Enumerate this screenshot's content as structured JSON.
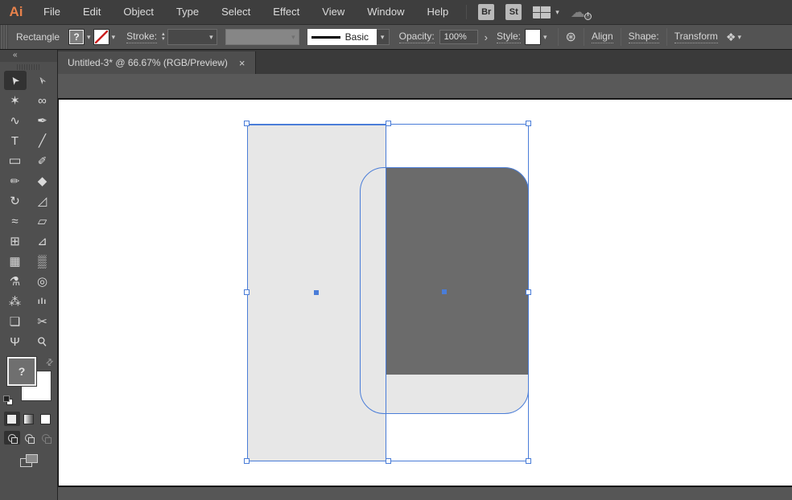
{
  "app": {
    "logo": "Ai"
  },
  "menubar": {
    "items": [
      "File",
      "Edit",
      "Object",
      "Type",
      "Select",
      "Effect",
      "View",
      "Window",
      "Help"
    ],
    "bridge_label": "Br",
    "stock_label": "St"
  },
  "controlbar": {
    "context_label": "Rectangle",
    "fill_value": "?",
    "stroke_label": "Stroke:",
    "brush_name": "Basic",
    "opacity_label": "Opacity:",
    "opacity_value": "100%",
    "style_label": "Style:",
    "align_label": "Align",
    "shape_label": "Shape:",
    "transform_label": "Transform"
  },
  "tabbar": {
    "title": "Untitled-3* @ 66.67% (RGB/Preview)",
    "close": "×"
  },
  "toolbar": {
    "collapse": "«",
    "fill_value": "?",
    "tools": [
      {
        "name": "selection-tool",
        "glyph": "➤",
        "active": true
      },
      {
        "name": "direct-selection-tool",
        "glyph": "➣"
      },
      {
        "name": "magic-wand-tool",
        "glyph": "✶"
      },
      {
        "name": "lasso-tool",
        "glyph": "∞"
      },
      {
        "name": "curvature-tool",
        "glyph": "∿"
      },
      {
        "name": "pen-tool",
        "glyph": "✒"
      },
      {
        "name": "type-tool",
        "glyph": "T"
      },
      {
        "name": "line-segment-tool",
        "glyph": "╱"
      },
      {
        "name": "rectangle-tool",
        "glyph": "▭"
      },
      {
        "name": "paintbrush-tool",
        "glyph": "✐"
      },
      {
        "name": "pencil-tool",
        "glyph": "✏"
      },
      {
        "name": "eraser-tool",
        "glyph": "◆"
      },
      {
        "name": "rotate-tool",
        "glyph": "↻"
      },
      {
        "name": "scale-tool",
        "glyph": "◿"
      },
      {
        "name": "width-tool",
        "glyph": "≈"
      },
      {
        "name": "free-transform-tool",
        "glyph": "▱"
      },
      {
        "name": "shape-builder-tool",
        "glyph": "⊞"
      },
      {
        "name": "perspective-grid-tool",
        "glyph": "⊿"
      },
      {
        "name": "mesh-tool",
        "glyph": "▦"
      },
      {
        "name": "gradient-tool",
        "glyph": "▒"
      },
      {
        "name": "eyedropper-tool",
        "glyph": "⚗"
      },
      {
        "name": "blend-tool",
        "glyph": "◎"
      },
      {
        "name": "symbol-sprayer-tool",
        "glyph": "⁂"
      },
      {
        "name": "column-graph-tool",
        "glyph": "ılı"
      },
      {
        "name": "artboard-tool",
        "glyph": "❏"
      },
      {
        "name": "slice-tool",
        "glyph": "✂"
      },
      {
        "name": "hand-tool",
        "glyph": "Ψ"
      },
      {
        "name": "zoom-tool",
        "glyph": "⚲"
      }
    ]
  },
  "icons": {
    "chevron-down": "▾",
    "stepper-up": "▴",
    "stepper-down": "▾",
    "arrow-next": "›",
    "swap": "⇄",
    "recolor": "⊛",
    "transform-options": "❖",
    "cloud": "☁"
  },
  "colors": {
    "selection": "#4a7dd8",
    "light-shape": "#e7e7e7",
    "dark-shape": "#6b6b6b",
    "artboard": "#ffffff",
    "accent-logo": "#e8824b",
    "none-red": "#cc2222"
  }
}
